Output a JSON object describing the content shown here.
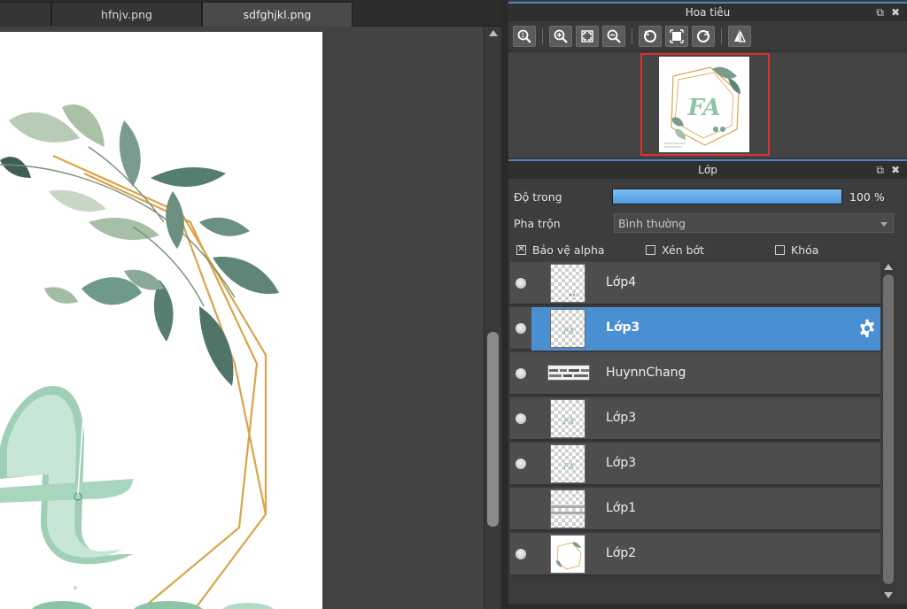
{
  "tabs": [
    {
      "label": "",
      "active": false
    },
    {
      "label": "hfnjv.png",
      "active": false
    },
    {
      "label": "sdfghjkl.png",
      "active": true
    }
  ],
  "navigator": {
    "title": "Hoa tiêu",
    "tools": [
      "zoom-actual-icon",
      "zoom-in-icon",
      "fit-screen-icon",
      "zoom-out-icon",
      "rotate-left-icon",
      "fit-window-icon",
      "rotate-right-icon",
      "flip-horizontal-icon"
    ],
    "preview_text": "FA"
  },
  "layers_panel": {
    "title": "Lớp",
    "opacity_label": "Độ trong",
    "opacity_value": "100 %",
    "opacity_fraction": 1.0,
    "blend_label": "Pha trộn",
    "blend_value": "Bình thường",
    "protect_alpha_label": "Bảo vệ alpha",
    "protect_alpha_checked": true,
    "clipping_label": "Xén bớt",
    "clipping_checked": false,
    "lock_label": "Khóa",
    "lock_checked": false
  },
  "layers": [
    {
      "name": "Lớp4",
      "visible": true,
      "selected": false,
      "thumb": "transparent-dots"
    },
    {
      "name": "Lớp3",
      "visible": true,
      "selected": true,
      "thumb": "fa-text"
    },
    {
      "name": "HuynnChang",
      "visible": true,
      "selected": false,
      "thumb": "text-strip"
    },
    {
      "name": "Lớp3",
      "visible": true,
      "selected": false,
      "thumb": "fa-text"
    },
    {
      "name": "Lớp3",
      "visible": true,
      "selected": false,
      "thumb": "fa-text"
    },
    {
      "name": "Lớp1",
      "visible": false,
      "selected": false,
      "thumb": "gray-lines"
    },
    {
      "name": "Lớp2",
      "visible": true,
      "selected": false,
      "thumb": "wreath"
    }
  ],
  "colors": {
    "accent": "#4a8fd2",
    "panel_header_line": "#4f86c6",
    "frame_red": "#e03030",
    "leaf_green": "#6f9a8a",
    "gold": "#d9a54a",
    "letter_green": "#8cc4a8"
  }
}
